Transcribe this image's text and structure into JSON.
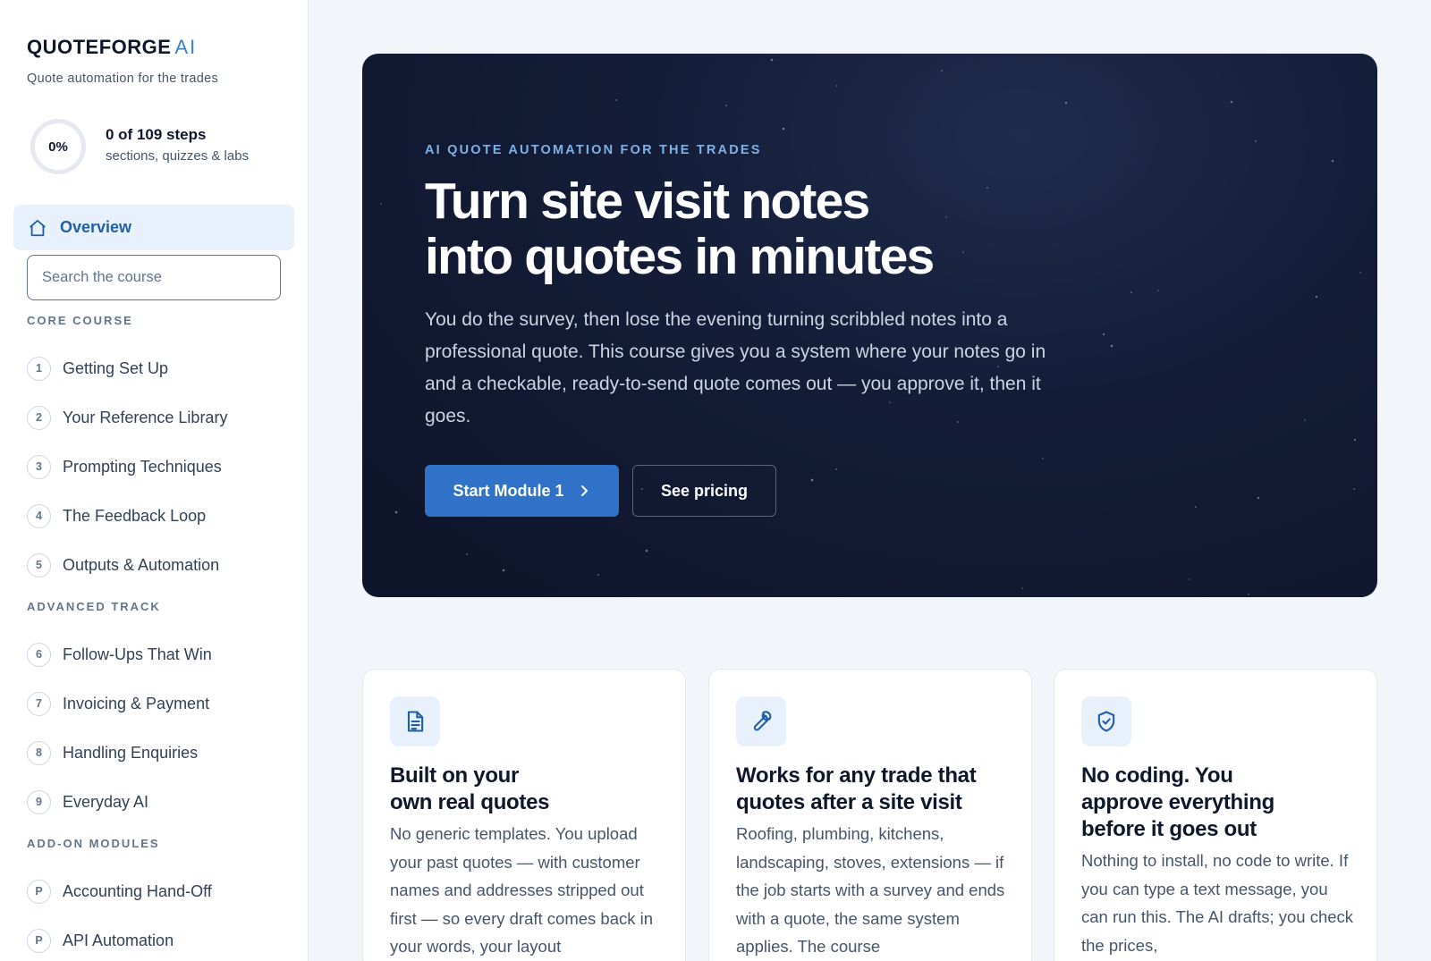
{
  "sidebar": {
    "brand": "QUOTEFORGE",
    "brand_suffix": "AI",
    "tagline": "Quote automation for the trades",
    "progress": {
      "percent_label": "0%",
      "percent_value": 0,
      "steps_label": "0 of 109 steps",
      "sub_label": "sections, quizzes & labs"
    },
    "overview_label": "Overview",
    "search_placeholder": "Search the course",
    "core_heading": "CORE COURSE",
    "core_items": [
      {
        "num": "1",
        "label": "Getting Set Up"
      },
      {
        "num": "2",
        "label": "Your Reference Library"
      },
      {
        "num": "3",
        "label": "Prompting Techniques"
      },
      {
        "num": "4",
        "label": "The Feedback Loop"
      },
      {
        "num": "5",
        "label": "Outputs & Automation"
      }
    ],
    "advanced_heading": "ADVANCED TRACK",
    "advanced_items": [
      {
        "num": "6",
        "label": "Follow-Ups That Win"
      },
      {
        "num": "7",
        "label": "Invoicing & Payment"
      },
      {
        "num": "8",
        "label": "Handling Enquiries"
      },
      {
        "num": "9",
        "label": "Everyday AI"
      }
    ],
    "addon_heading": "ADD-ON MODULES",
    "addon_items": [
      {
        "num": "P",
        "label": "Accounting Hand-Off"
      },
      {
        "num": "P",
        "label": "API Automation"
      }
    ]
  },
  "hero": {
    "eyebrow": "AI QUOTE AUTOMATION FOR THE TRADES",
    "headline_line1": "Turn site visit notes",
    "headline_line2": "into quotes in minutes",
    "lede": "You do the survey, then lose the evening turning scribbled notes into a professional quote. This course gives you a system where your notes go in and a checkable, ready-to-send quote comes out — you approve it, then it goes.",
    "primary_button": "Start Module 1",
    "secondary_button": "See pricing"
  },
  "cards": [
    {
      "icon": "document-icon",
      "title_line1": "Built on your",
      "title_line2": "own real quotes",
      "body": "No generic templates. You upload your past quotes — with customer names and addresses stripped out first — so every draft comes back in your words, your layout"
    },
    {
      "icon": "wrench-icon",
      "title_line1": "Works for any trade that",
      "title_line2": "quotes after a site visit",
      "body": "Roofing, plumbing, kitchens, landscaping, stoves, extensions — if the job starts with a survey and ends with a quote, the same system applies. The course"
    },
    {
      "icon": "shield-check-icon",
      "title_line1": "No coding. You",
      "title_line2": "approve everything",
      "title_line3": "before it goes out",
      "body": "Nothing to install, no code to write. If you can type a text message, you can run this. The AI drafts; you check the prices,"
    }
  ],
  "colors": {
    "accent": "#2f72c8",
    "accent_light": "#e8f1fb",
    "hero_bg": "#141d38",
    "page_bg": "#f2f5f9"
  }
}
